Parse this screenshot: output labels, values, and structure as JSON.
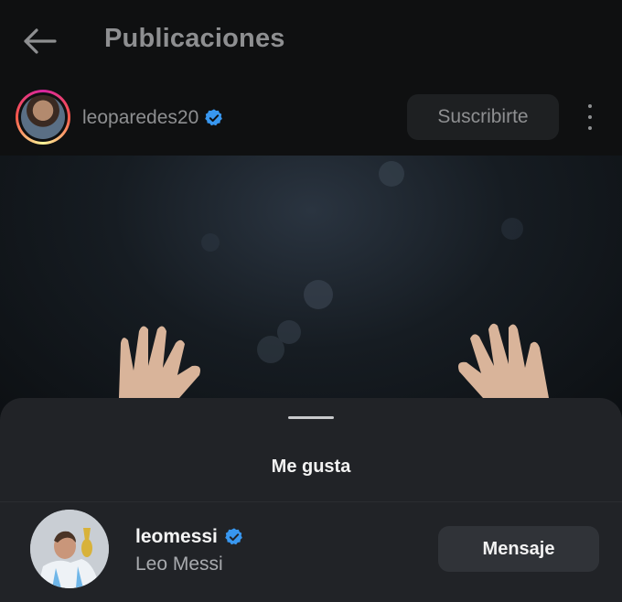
{
  "header": {
    "title": "Publicaciones",
    "back_icon": "arrow-left-icon"
  },
  "post": {
    "username": "leoparedes20",
    "verified": true,
    "subscribe_label": "Suscribirte",
    "more_icon": "more-vertical-icon"
  },
  "likes_sheet": {
    "title": "Me gusta",
    "users": [
      {
        "username": "leomessi",
        "full_name": "Leo Messi",
        "verified": true,
        "action_label": "Mensaje"
      }
    ]
  },
  "colors": {
    "background": "#0f1011",
    "sheet": "#212327",
    "verified_blue": "#3897f0",
    "button": "#303338"
  }
}
